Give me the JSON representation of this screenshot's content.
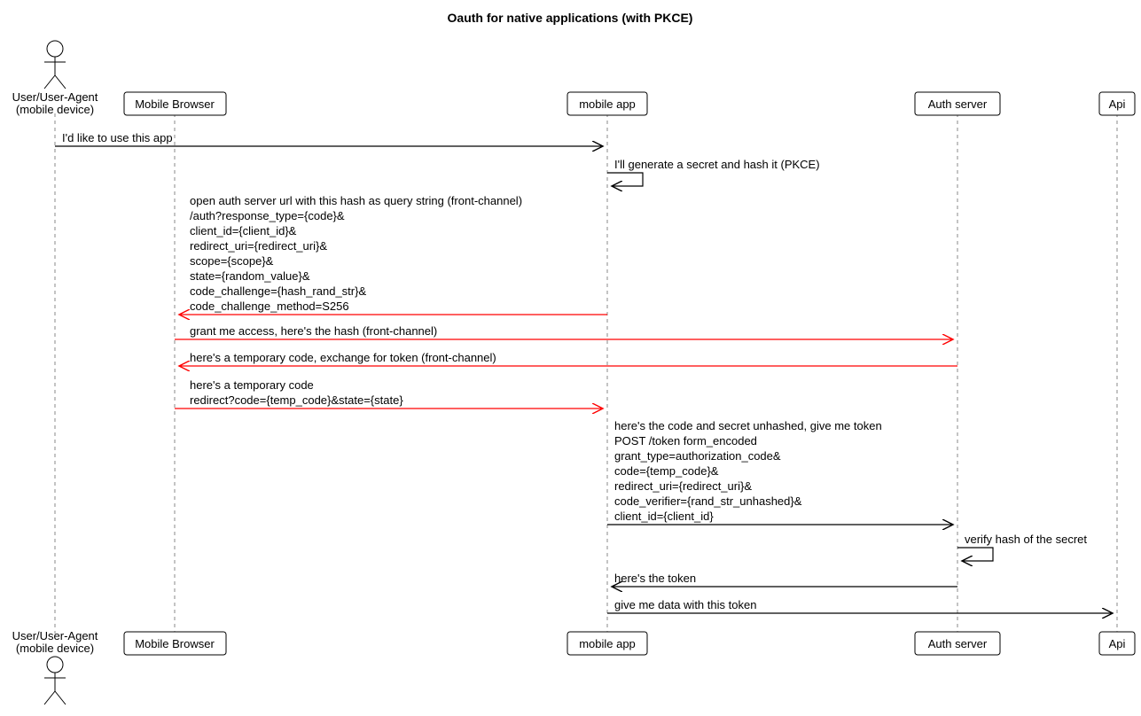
{
  "title": "Oauth for native applications (with PKCE)",
  "participants": {
    "actor": "User/User-Agent",
    "actor_sub": "(mobile device)",
    "browser": "Mobile Browser",
    "app": "mobile app",
    "auth": "Auth server",
    "api": "Api"
  },
  "messages": {
    "m1": "I'd like to use this app",
    "m2": "I'll generate a secret and hash it (PKCE)",
    "m3_l1": "open auth server url with this hash as query string (front-channel)",
    "m3_l2": "/auth?response_type={code}&",
    "m3_l3": "client_id={client_id}&",
    "m3_l4": "redirect_uri={redirect_uri}&",
    "m3_l5": "scope={scope}&",
    "m3_l6": "state={random_value}&",
    "m3_l7": "code_challenge={hash_rand_str}&",
    "m3_l8": "code_challenge_method=S256",
    "m4": "grant me access, here's the hash (front-channel)",
    "m5": "here's a temporary code, exchange for token (front-channel)",
    "m6_l1": "here's a temporary code",
    "m6_l2": "redirect?code={temp_code}&state={state}",
    "m7_l1": "here's the code and secret unhashed, give me token",
    "m7_l2": "POST /token form_encoded",
    "m7_l3": "grant_type=authorization_code&",
    "m7_l4": "code={temp_code}&",
    "m7_l5": "redirect_uri={redirect_uri}&",
    "m7_l6": "code_verifier={rand_str_unhashed}&",
    "m7_l7": "client_id={client_id}",
    "m8": "verify hash of the secret",
    "m9": "here's the token",
    "m10": "give me data with this token"
  }
}
